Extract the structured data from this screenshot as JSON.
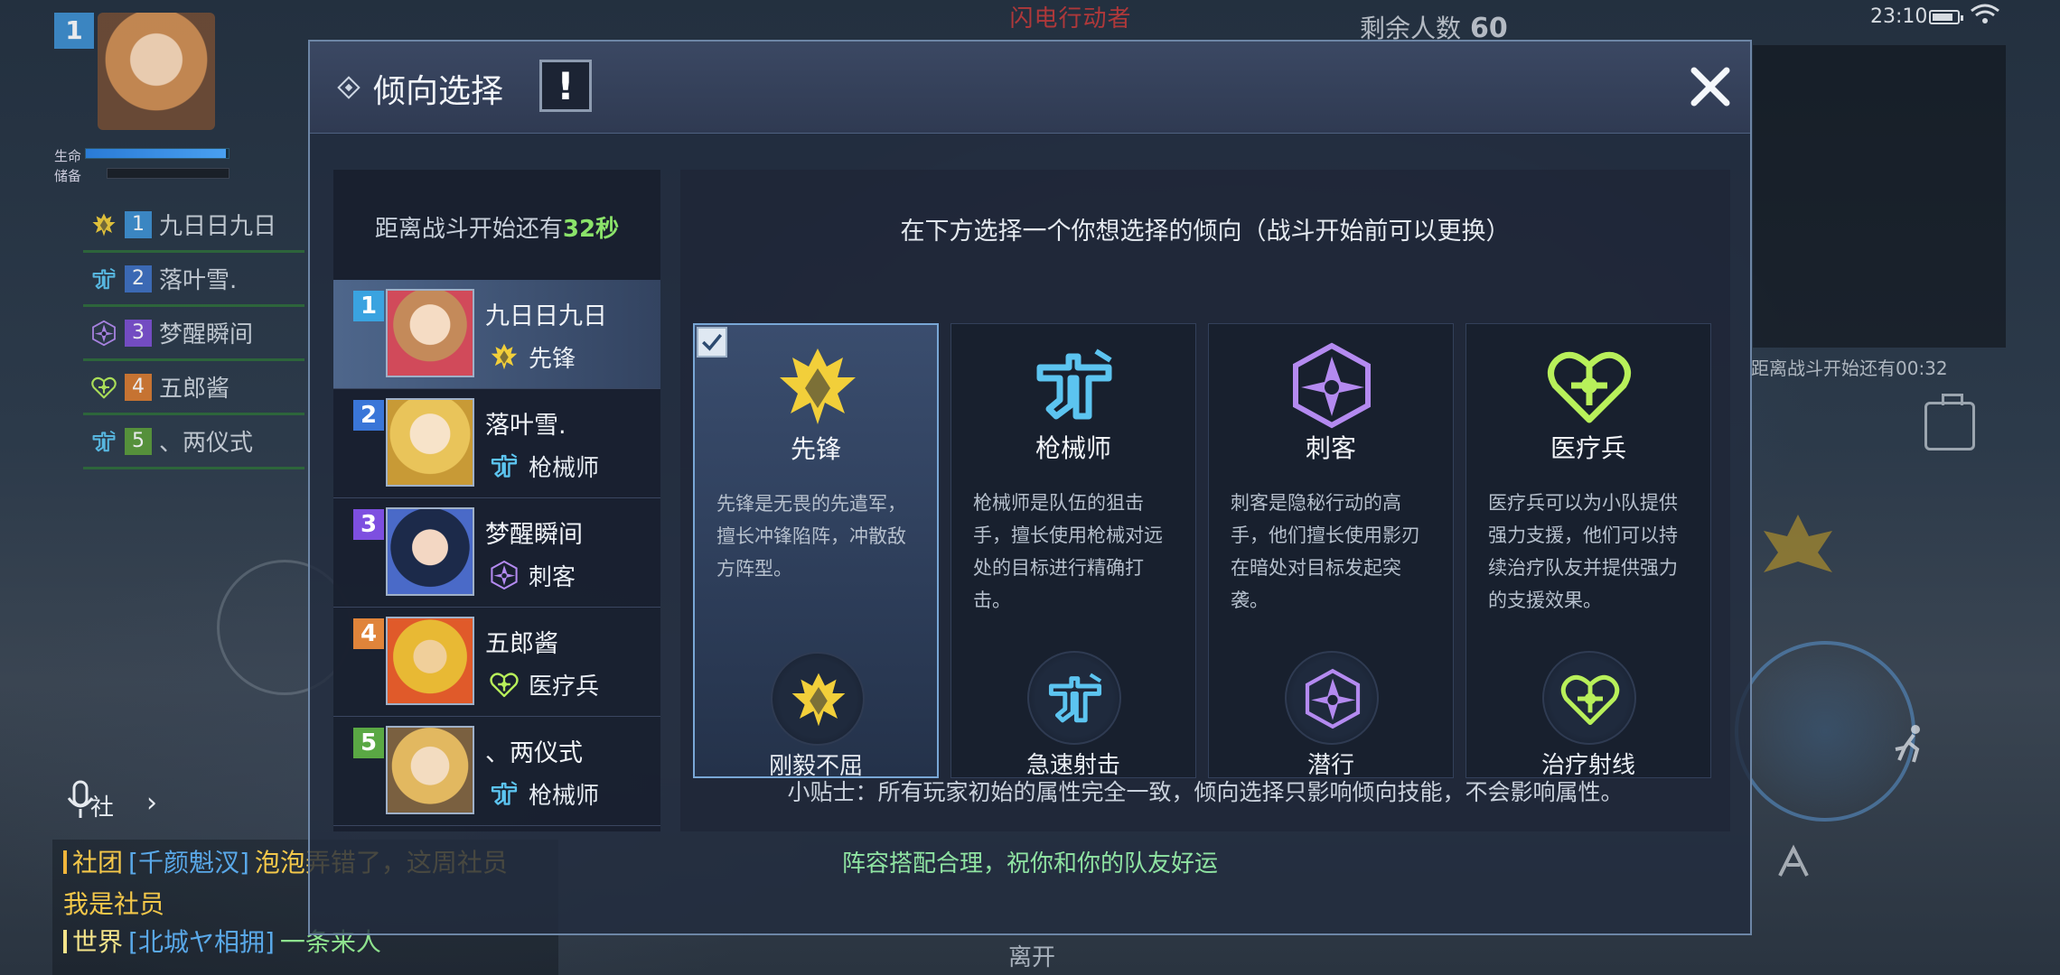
{
  "hud": {
    "event_title": "闪电行动者",
    "remaining_label": "剩余人数",
    "remaining_count": "60",
    "clock": "23:10",
    "player_level": "1",
    "hp_label": "生命",
    "store_label": "储备",
    "hp_fraction": 0.98,
    "team": [
      {
        "num": "1",
        "name": "九日日九日",
        "num_color": "#3e8fd0"
      },
      {
        "num": "2",
        "name": "落叶雪.",
        "num_color": "#3e6fc0"
      },
      {
        "num": "3",
        "name": "梦醒瞬间",
        "num_color": "#7b4fd0"
      },
      {
        "num": "4",
        "name": "五郎酱",
        "num_color": "#d77a30"
      },
      {
        "num": "5",
        "name": "、两仪式",
        "num_color": "#5a9a3a"
      }
    ],
    "minimap_countdown": "距离战斗开始还有00:32"
  },
  "chat": {
    "mic_label": "社",
    "lines": [
      {
        "channel": "社团",
        "user": "[千颜魁汊]",
        "message": "泡泡弄错了，这周社员"
      },
      {
        "continuation": "我是社员"
      },
      {
        "channel": "世界",
        "user": "[北城ヤ相拥]",
        "message": "一条来人"
      }
    ]
  },
  "modal": {
    "title": "倾向选择",
    "info_label": "!",
    "countdown_prefix": "距离战斗开始还有",
    "countdown_seconds": "32秒",
    "instruction": "在下方选择一个你想选择的倾向（战斗开始前可以更换）",
    "members": [
      {
        "num": "1",
        "name": "九日日九日",
        "role": "先锋",
        "num_color": "#3aa3e0",
        "role_icon": "vanguard-icon"
      },
      {
        "num": "2",
        "name": "落叶雪.",
        "role": "枪械师",
        "num_color": "#3a76d8",
        "role_icon": "gunsmith-icon"
      },
      {
        "num": "3",
        "name": "梦醒瞬间",
        "role": "刺客",
        "num_color": "#7d4fe0",
        "role_icon": "assassin-icon"
      },
      {
        "num": "4",
        "name": "五郎酱",
        "role": "医疗兵",
        "num_color": "#e0843a",
        "role_icon": "medic-icon"
      },
      {
        "num": "5",
        "name": "、两仪式",
        "role": "枪械师",
        "num_color": "#5aa844",
        "role_icon": "gunsmith-icon"
      }
    ],
    "tendencies": [
      {
        "name": "先锋",
        "desc": "先锋是无畏的先遣军，擅长冲锋陷阵，冲散敌方阵型。",
        "skill": "刚毅不屈",
        "color": "#f2cf3a",
        "selected": true
      },
      {
        "name": "枪械师",
        "desc": "枪械师是队伍的狙击手，擅长使用枪械对远处的目标进行精确打击。",
        "skill": "急速射击",
        "color": "#5cc4f0",
        "selected": false
      },
      {
        "name": "刺客",
        "desc": "刺客是隐秘行动的高手，他们擅长使用影刃在暗处对目标发起突袭。",
        "skill": "潜行",
        "color": "#b48af0",
        "selected": false
      },
      {
        "name": "医疗兵",
        "desc": "医疗兵可以为小队提供强力支援，他们可以持续治疗队友并提供强力的支援效果。",
        "skill": "治疗射线",
        "color": "#b8f05a",
        "selected": false
      }
    ],
    "tip": "小贴士：所有玩家初始的属性完全一致，倾向选择只影响倾向技能，不会影响属性。",
    "footer": "阵容搭配合理，祝你和你的队友好运",
    "leave_label": "离开"
  }
}
